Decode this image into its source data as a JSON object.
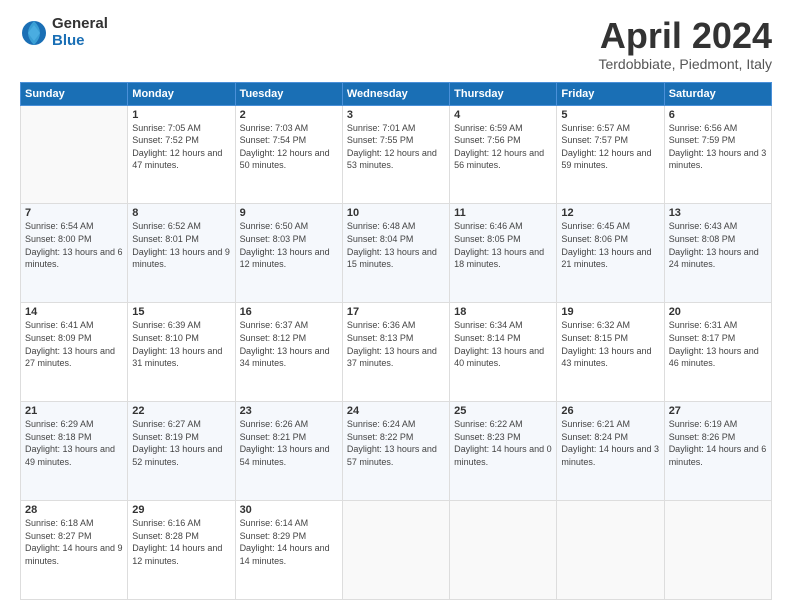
{
  "logo": {
    "general": "General",
    "blue": "Blue"
  },
  "header": {
    "month": "April 2024",
    "location": "Terdobbiate, Piedmont, Italy"
  },
  "weekdays": [
    "Sunday",
    "Monday",
    "Tuesday",
    "Wednesday",
    "Thursday",
    "Friday",
    "Saturday"
  ],
  "weeks": [
    [
      {
        "day": "",
        "empty": true
      },
      {
        "day": "1",
        "sunrise": "7:05 AM",
        "sunset": "7:52 PM",
        "daylight": "12 hours and 47 minutes."
      },
      {
        "day": "2",
        "sunrise": "7:03 AM",
        "sunset": "7:54 PM",
        "daylight": "12 hours and 50 minutes."
      },
      {
        "day": "3",
        "sunrise": "7:01 AM",
        "sunset": "7:55 PM",
        "daylight": "12 hours and 53 minutes."
      },
      {
        "day": "4",
        "sunrise": "6:59 AM",
        "sunset": "7:56 PM",
        "daylight": "12 hours and 56 minutes."
      },
      {
        "day": "5",
        "sunrise": "6:57 AM",
        "sunset": "7:57 PM",
        "daylight": "12 hours and 59 minutes."
      },
      {
        "day": "6",
        "sunrise": "6:56 AM",
        "sunset": "7:59 PM",
        "daylight": "13 hours and 3 minutes."
      }
    ],
    [
      {
        "day": "7",
        "sunrise": "6:54 AM",
        "sunset": "8:00 PM",
        "daylight": "13 hours and 6 minutes."
      },
      {
        "day": "8",
        "sunrise": "6:52 AM",
        "sunset": "8:01 PM",
        "daylight": "13 hours and 9 minutes."
      },
      {
        "day": "9",
        "sunrise": "6:50 AM",
        "sunset": "8:03 PM",
        "daylight": "13 hours and 12 minutes."
      },
      {
        "day": "10",
        "sunrise": "6:48 AM",
        "sunset": "8:04 PM",
        "daylight": "13 hours and 15 minutes."
      },
      {
        "day": "11",
        "sunrise": "6:46 AM",
        "sunset": "8:05 PM",
        "daylight": "13 hours and 18 minutes."
      },
      {
        "day": "12",
        "sunrise": "6:45 AM",
        "sunset": "8:06 PM",
        "daylight": "13 hours and 21 minutes."
      },
      {
        "day": "13",
        "sunrise": "6:43 AM",
        "sunset": "8:08 PM",
        "daylight": "13 hours and 24 minutes."
      }
    ],
    [
      {
        "day": "14",
        "sunrise": "6:41 AM",
        "sunset": "8:09 PM",
        "daylight": "13 hours and 27 minutes."
      },
      {
        "day": "15",
        "sunrise": "6:39 AM",
        "sunset": "8:10 PM",
        "daylight": "13 hours and 31 minutes."
      },
      {
        "day": "16",
        "sunrise": "6:37 AM",
        "sunset": "8:12 PM",
        "daylight": "13 hours and 34 minutes."
      },
      {
        "day": "17",
        "sunrise": "6:36 AM",
        "sunset": "8:13 PM",
        "daylight": "13 hours and 37 minutes."
      },
      {
        "day": "18",
        "sunrise": "6:34 AM",
        "sunset": "8:14 PM",
        "daylight": "13 hours and 40 minutes."
      },
      {
        "day": "19",
        "sunrise": "6:32 AM",
        "sunset": "8:15 PM",
        "daylight": "13 hours and 43 minutes."
      },
      {
        "day": "20",
        "sunrise": "6:31 AM",
        "sunset": "8:17 PM",
        "daylight": "13 hours and 46 minutes."
      }
    ],
    [
      {
        "day": "21",
        "sunrise": "6:29 AM",
        "sunset": "8:18 PM",
        "daylight": "13 hours and 49 minutes."
      },
      {
        "day": "22",
        "sunrise": "6:27 AM",
        "sunset": "8:19 PM",
        "daylight": "13 hours and 52 minutes."
      },
      {
        "day": "23",
        "sunrise": "6:26 AM",
        "sunset": "8:21 PM",
        "daylight": "13 hours and 54 minutes."
      },
      {
        "day": "24",
        "sunrise": "6:24 AM",
        "sunset": "8:22 PM",
        "daylight": "13 hours and 57 minutes."
      },
      {
        "day": "25",
        "sunrise": "6:22 AM",
        "sunset": "8:23 PM",
        "daylight": "14 hours and 0 minutes."
      },
      {
        "day": "26",
        "sunrise": "6:21 AM",
        "sunset": "8:24 PM",
        "daylight": "14 hours and 3 minutes."
      },
      {
        "day": "27",
        "sunrise": "6:19 AM",
        "sunset": "8:26 PM",
        "daylight": "14 hours and 6 minutes."
      }
    ],
    [
      {
        "day": "28",
        "sunrise": "6:18 AM",
        "sunset": "8:27 PM",
        "daylight": "14 hours and 9 minutes."
      },
      {
        "day": "29",
        "sunrise": "6:16 AM",
        "sunset": "8:28 PM",
        "daylight": "14 hours and 12 minutes."
      },
      {
        "day": "30",
        "sunrise": "6:14 AM",
        "sunset": "8:29 PM",
        "daylight": "14 hours and 14 minutes."
      },
      {
        "day": "",
        "empty": true
      },
      {
        "day": "",
        "empty": true
      },
      {
        "day": "",
        "empty": true
      },
      {
        "day": "",
        "empty": true
      }
    ]
  ],
  "labels": {
    "sunrise": "Sunrise:",
    "sunset": "Sunset:",
    "daylight": "Daylight:"
  }
}
